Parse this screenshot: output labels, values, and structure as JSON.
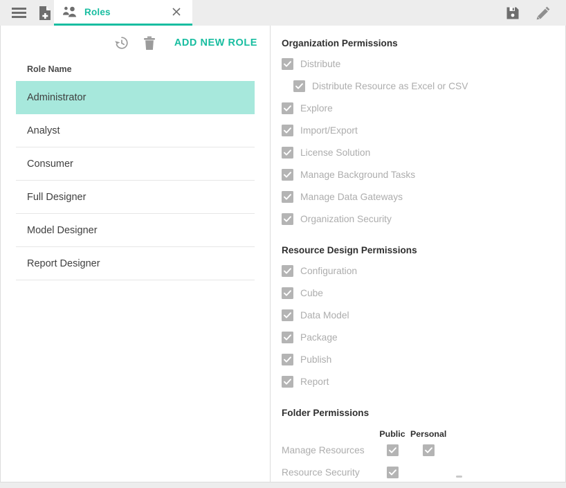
{
  "topbar": {
    "menu_icon": "hamburger-icon",
    "new_document_icon": "new-document-icon",
    "save_icon": "save-icon",
    "edit_icon": "pencil-edit-icon",
    "tab": {
      "icon": "people-icon",
      "label": "Roles",
      "close_icon": "close-icon"
    }
  },
  "left_panel": {
    "toolbar": {
      "history_icon": "history-restore-icon",
      "delete_icon": "trash-delete-icon",
      "add_new_role_label": "ADD NEW ROLE"
    },
    "list_header": "Role Name",
    "roles": [
      {
        "name": "Administrator",
        "selected": true
      },
      {
        "name": "Analyst",
        "selected": false
      },
      {
        "name": "Consumer",
        "selected": false
      },
      {
        "name": "Full Designer",
        "selected": false
      },
      {
        "name": "Model Designer",
        "selected": false
      },
      {
        "name": "Report Designer",
        "selected": false
      }
    ]
  },
  "right_panel": {
    "organization": {
      "title": "Organization Permissions",
      "items": [
        {
          "label": "Distribute",
          "checked": true,
          "indent": false
        },
        {
          "label": "Distribute Resource as Excel or CSV",
          "checked": true,
          "indent": true
        },
        {
          "label": "Explore",
          "checked": true,
          "indent": false
        },
        {
          "label": "Import/Export",
          "checked": true,
          "indent": false
        },
        {
          "label": "License Solution",
          "checked": true,
          "indent": false
        },
        {
          "label": "Manage Background Tasks",
          "checked": true,
          "indent": false
        },
        {
          "label": "Manage Data Gateways",
          "checked": true,
          "indent": false
        },
        {
          "label": "Organization Security",
          "checked": true,
          "indent": false
        }
      ]
    },
    "resource_design": {
      "title": "Resource Design Permissions",
      "items": [
        {
          "label": "Configuration",
          "checked": true,
          "indent": false
        },
        {
          "label": "Cube",
          "checked": true,
          "indent": false
        },
        {
          "label": "Data Model",
          "checked": true,
          "indent": false
        },
        {
          "label": "Package",
          "checked": true,
          "indent": false
        },
        {
          "label": "Publish",
          "checked": true,
          "indent": false
        },
        {
          "label": "Report",
          "checked": true,
          "indent": false
        }
      ]
    },
    "folder": {
      "title": "Folder Permissions",
      "columns": [
        "Public",
        "Personal"
      ],
      "rows": [
        {
          "label": "Manage Resources",
          "public": true,
          "personal": true
        },
        {
          "label": "Resource Security",
          "public": true,
          "personal": null
        }
      ]
    }
  },
  "colors": {
    "accent_teal": "#18bda0",
    "selected_row": "#a7e8dc",
    "checkbox_grey": "#b4b4b4",
    "disabled_text": "#adadad",
    "chrome_grey": "#ededed"
  }
}
